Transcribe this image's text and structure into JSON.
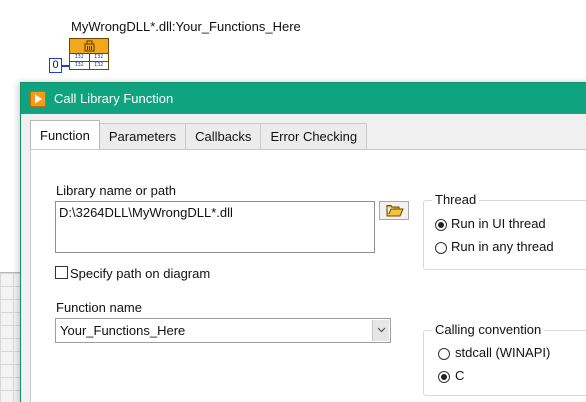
{
  "diagram": {
    "node_caption": "MyWrongDLL*.dll:Your_Functions_Here",
    "constant_value": "0",
    "node_terminals": [
      "I32",
      "I32",
      "I32",
      "I32"
    ]
  },
  "dialog": {
    "title": "Call Library Function",
    "tabs": [
      {
        "label": "Function",
        "active": true
      },
      {
        "label": "Parameters",
        "active": false
      },
      {
        "label": "Callbacks",
        "active": false
      },
      {
        "label": "Error Checking",
        "active": false
      }
    ],
    "library": {
      "label": "Library name or path",
      "value": "D:\\3264DLL\\MyWrongDLL*.dll",
      "specify_path_label": "Specify path on diagram",
      "specify_path_checked": false
    },
    "function": {
      "label": "Function name",
      "value": "Your_Functions_Here"
    },
    "thread": {
      "title": "Thread",
      "options": [
        {
          "label": "Run in UI thread",
          "checked": true
        },
        {
          "label": "Run in any thread",
          "checked": false
        }
      ]
    },
    "calling_convention": {
      "title": "Calling convention",
      "options": [
        {
          "label": "stdcall (WINAPI)",
          "checked": false
        },
        {
          "label": "C",
          "checked": true
        }
      ]
    }
  },
  "colors": {
    "titlebar": "#10a37f",
    "node_header": "#f2a81d",
    "wire": "#1c3fcf"
  }
}
